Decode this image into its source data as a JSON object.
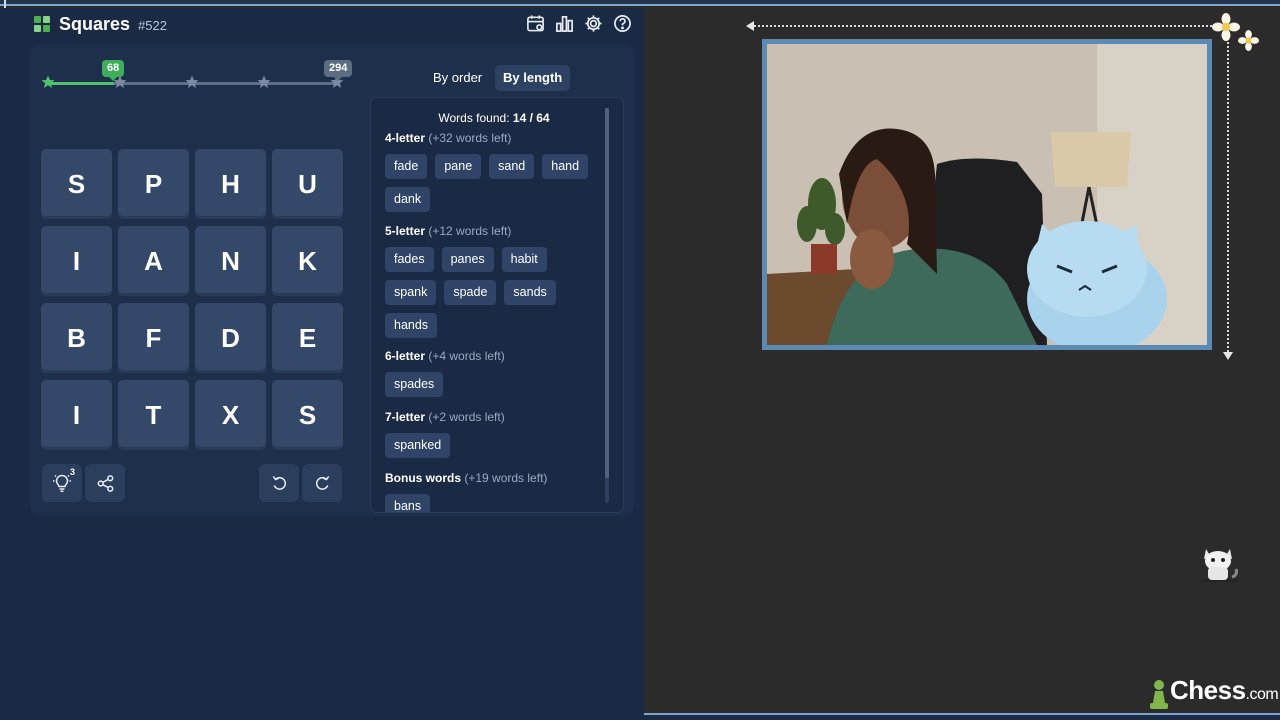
{
  "header": {
    "title": "Squares",
    "puzzle_number": "#522",
    "icons": [
      "calendar-icon",
      "stats-icon",
      "settings-icon",
      "help-icon"
    ]
  },
  "progress": {
    "current_score": "68",
    "max_score": "294",
    "fraction": 0.23
  },
  "sort": {
    "by_order": "By order",
    "by_length": "By length",
    "active": "by_length"
  },
  "grid": [
    [
      "S",
      "P",
      "H",
      "U"
    ],
    [
      "I",
      "A",
      "N",
      "K"
    ],
    [
      "B",
      "F",
      "D",
      "E"
    ],
    [
      "I",
      "T",
      "X",
      "S"
    ]
  ],
  "controls": {
    "hint_count": "3"
  },
  "words": {
    "found_label": "Words found:",
    "found_value": "14 / 64",
    "sections": [
      {
        "title": "4-letter",
        "left": "(+32 words left)",
        "words": [
          "fade",
          "pane",
          "sand",
          "hand",
          "dank"
        ]
      },
      {
        "title": "5-letter",
        "left": "(+12 words left)",
        "words": [
          "fades",
          "panes",
          "habit",
          "spank",
          "spade",
          "sands",
          "hands"
        ]
      },
      {
        "title": "6-letter",
        "left": "(+4 words left)",
        "words": [
          "spades"
        ]
      },
      {
        "title": "7-letter",
        "left": "(+2 words left)",
        "words": [
          "spanked"
        ]
      },
      {
        "title": "Bonus words",
        "left": "(+19 words left)",
        "words": [
          "bans"
        ]
      }
    ]
  },
  "brand": {
    "name": "Chess",
    "suffix": ".com"
  },
  "colors": {
    "panel_bg": "#1b2a44",
    "tile_bg": "#34486a",
    "accent_green": "#4fc36a",
    "chip_bg": "#2f4466",
    "cam_border": "#5b8ab3"
  }
}
